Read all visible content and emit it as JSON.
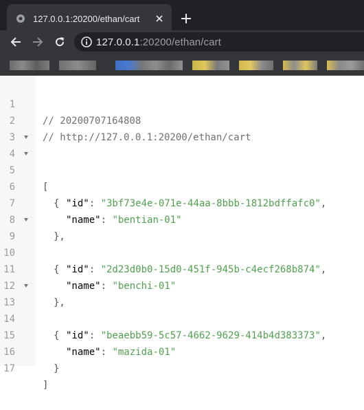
{
  "tab": {
    "title": "127.0.0.1:20200/ethan/cart"
  },
  "address": {
    "host": "127.0.0.1",
    "rest": ":20200/ethan/cart"
  },
  "icons": {
    "favicon": "globe-icon",
    "close": "close-icon",
    "new_tab": "plus-icon",
    "back": "arrow-left-icon",
    "forward": "arrow-right-icon",
    "reload": "reload-icon",
    "info": "info-icon"
  },
  "colors": {
    "chrome_dark": "#202124",
    "chrome_toolbar": "#35363a",
    "string": "#50a14f"
  },
  "lines": [
    {
      "n": "1",
      "comment": "// 20200707164808"
    },
    {
      "n": "2",
      "comment": "// http://127.0.0.1:20200/ethan/cart"
    },
    {
      "n": "3"
    },
    {
      "n": "4",
      "punc": "["
    },
    {
      "n": "5",
      "punc": "{"
    },
    {
      "n": "6",
      "key": "\"id\"",
      "value": "\"3bf73e4e-071e-44aa-8bbb-1812bdffafc0\"",
      "tail": ","
    },
    {
      "n": "7",
      "key": "\"name\"",
      "value": "\"bentian-01\"",
      "tail": ""
    },
    {
      "n": "8",
      "punc": "},"
    },
    {
      "n": "9",
      "punc": "{"
    },
    {
      "n": "10",
      "key": "\"id\"",
      "value": "\"2d23d0b0-15d0-451f-945b-c4ecf268b874\"",
      "tail": ","
    },
    {
      "n": "11",
      "key": "\"name\"",
      "value": "\"benchi-01\"",
      "tail": ""
    },
    {
      "n": "12",
      "punc": "},"
    },
    {
      "n": "13",
      "punc": "{"
    },
    {
      "n": "14",
      "key": "\"id\"",
      "value": "\"beaebb59-5c57-4662-9629-414b4d383373\"",
      "tail": ","
    },
    {
      "n": "15",
      "key": "\"name\"",
      "value": "\"mazida-01\"",
      "tail": ""
    },
    {
      "n": "16",
      "punc": "}"
    },
    {
      "n": "17",
      "punc": "]"
    }
  ]
}
